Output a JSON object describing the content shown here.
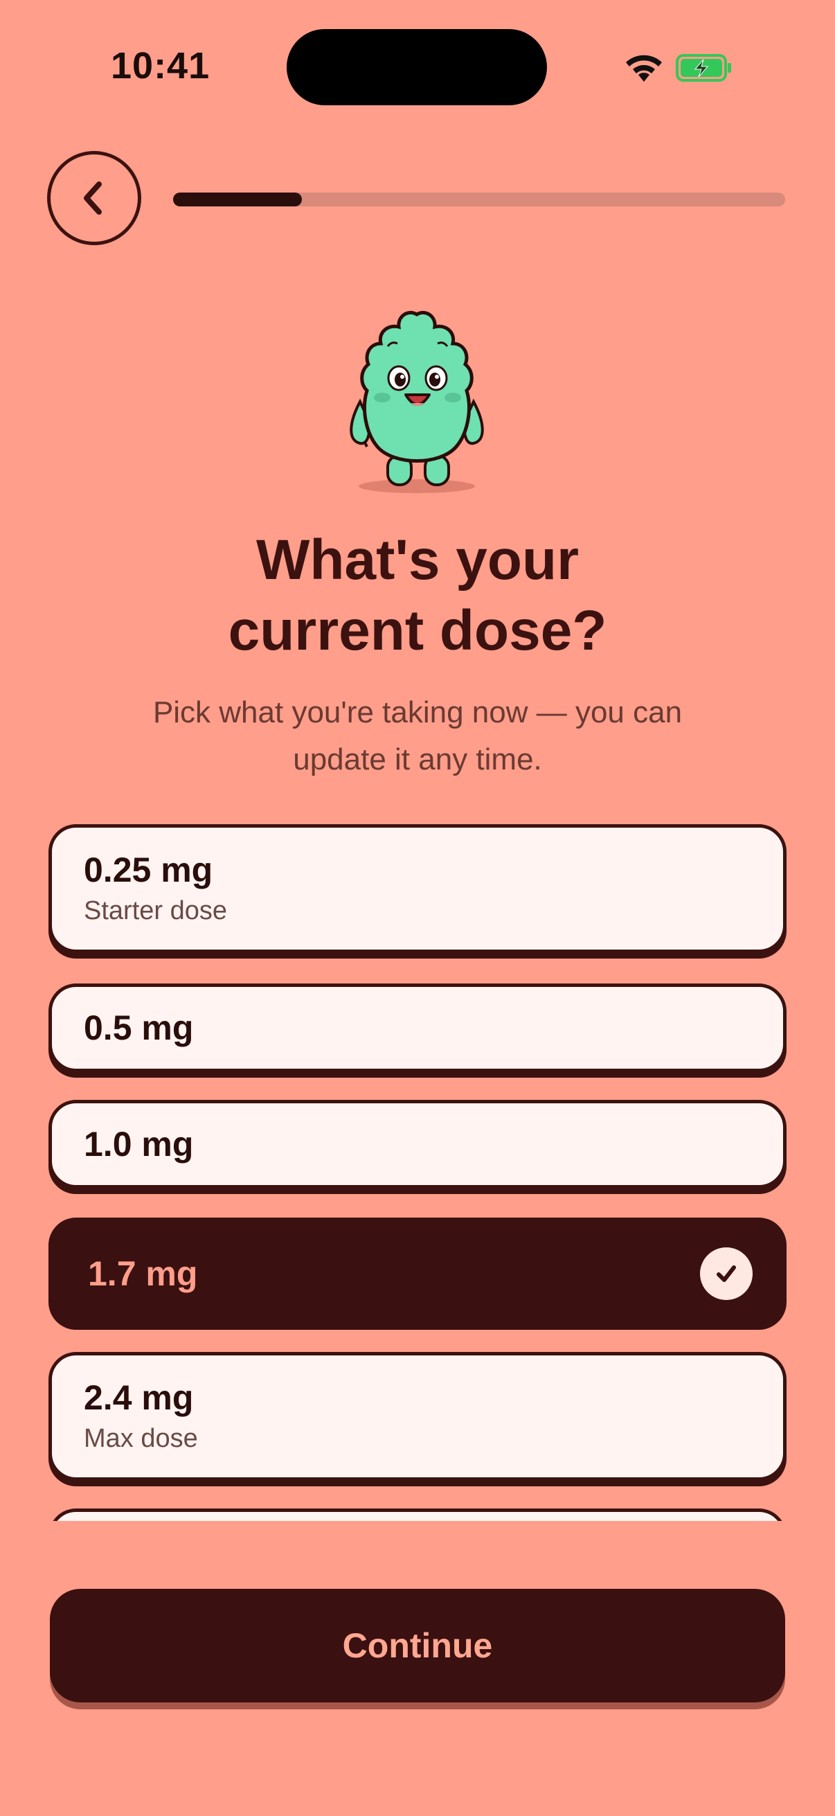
{
  "status_bar": {
    "time": "10:41",
    "battery_color": "#34C759"
  },
  "header": {
    "back_icon": "chevron-left-icon",
    "progress_fraction": 0.21
  },
  "hero": {
    "mascot": "green-fuzzy-monster",
    "title_line1": "What's your",
    "title_line2": "current dose?",
    "subtitle_line1": "Pick what you're taking now — you can",
    "subtitle_line2": "update it any time."
  },
  "options": [
    {
      "label": "0.25 mg",
      "sub": "Starter dose",
      "selected": false
    },
    {
      "label": "0.5 mg",
      "sub": "",
      "selected": false
    },
    {
      "label": "1.0 mg",
      "sub": "",
      "selected": false
    },
    {
      "label": "1.7 mg",
      "sub": "",
      "selected": true
    },
    {
      "label": "2.4 mg",
      "sub": "Max dose",
      "selected": false
    }
  ],
  "footer": {
    "continue_label": "Continue"
  },
  "colors": {
    "background": "#FF9E8A",
    "dark": "#3A1010",
    "card": "#FFF4F1",
    "accent_text": "#FFA791"
  }
}
